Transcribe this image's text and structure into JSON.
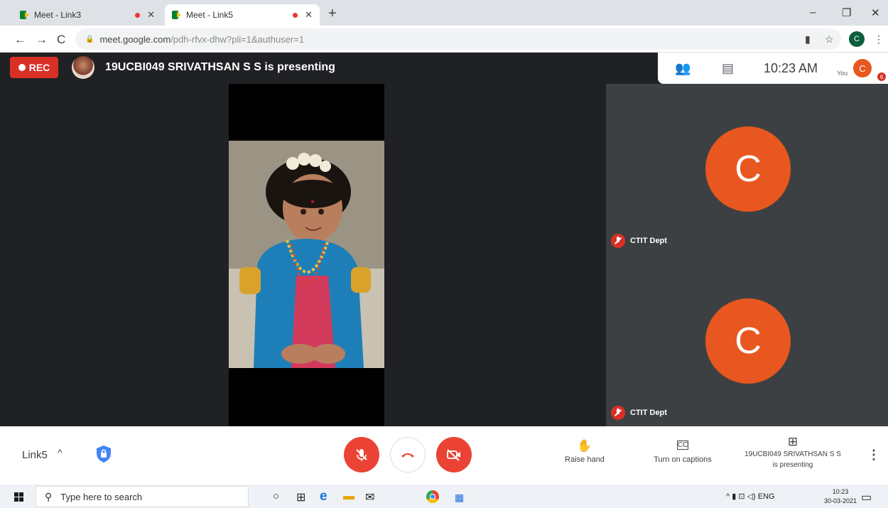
{
  "browser": {
    "tabs": [
      {
        "title": "Meet - Link3",
        "recording": true
      },
      {
        "title": "Meet - Link5",
        "recording": true,
        "active": true
      }
    ],
    "new_tab": "+",
    "window_controls": {
      "minimize": "–",
      "restore": "❐",
      "close": "✕"
    },
    "nav": {
      "back": "←",
      "forward": "→",
      "reload": "C"
    },
    "url_host": "meet.google.com",
    "url_path": "/pdh-rfvx-dhw?pli=1&authuser=1",
    "profile_initial": "C",
    "icons": {
      "camera": "▮",
      "star": "☆",
      "menu": "⋮"
    }
  },
  "meet": {
    "rec_label": "REC",
    "presenting_text": "19UCBI049 SRIVATHSAN S S is presenting",
    "time": "10:23 AM",
    "you_label": "You",
    "you_initial": "C",
    "notification_count": "6",
    "icons": {
      "people": "👥",
      "chat": "▤"
    },
    "tiles": [
      {
        "initial": "C",
        "name": "CTIT Dept",
        "muted": true
      },
      {
        "initial": "C",
        "name": "CTIT Dept",
        "muted": true
      }
    ]
  },
  "controls": {
    "meeting_name": "Link5",
    "chevron": "^",
    "raise_hand_label": "Raise hand",
    "raise_hand_icon": "✋",
    "captions_label": "Turn on captions",
    "captions_icon": "CC",
    "present_label_1": "19UCBI049 SRIVATHSAN S S",
    "present_label_2": "is presenting",
    "present_icon": "⊞",
    "more": "⋮"
  },
  "taskbar": {
    "search_placeholder": "Type here to search",
    "search_icon": "⚲",
    "tray_text": "^ ▮ ⊡ ◁) ENG",
    "time": "10:23",
    "date": "30-03-2021",
    "notification_icon": "▭"
  }
}
